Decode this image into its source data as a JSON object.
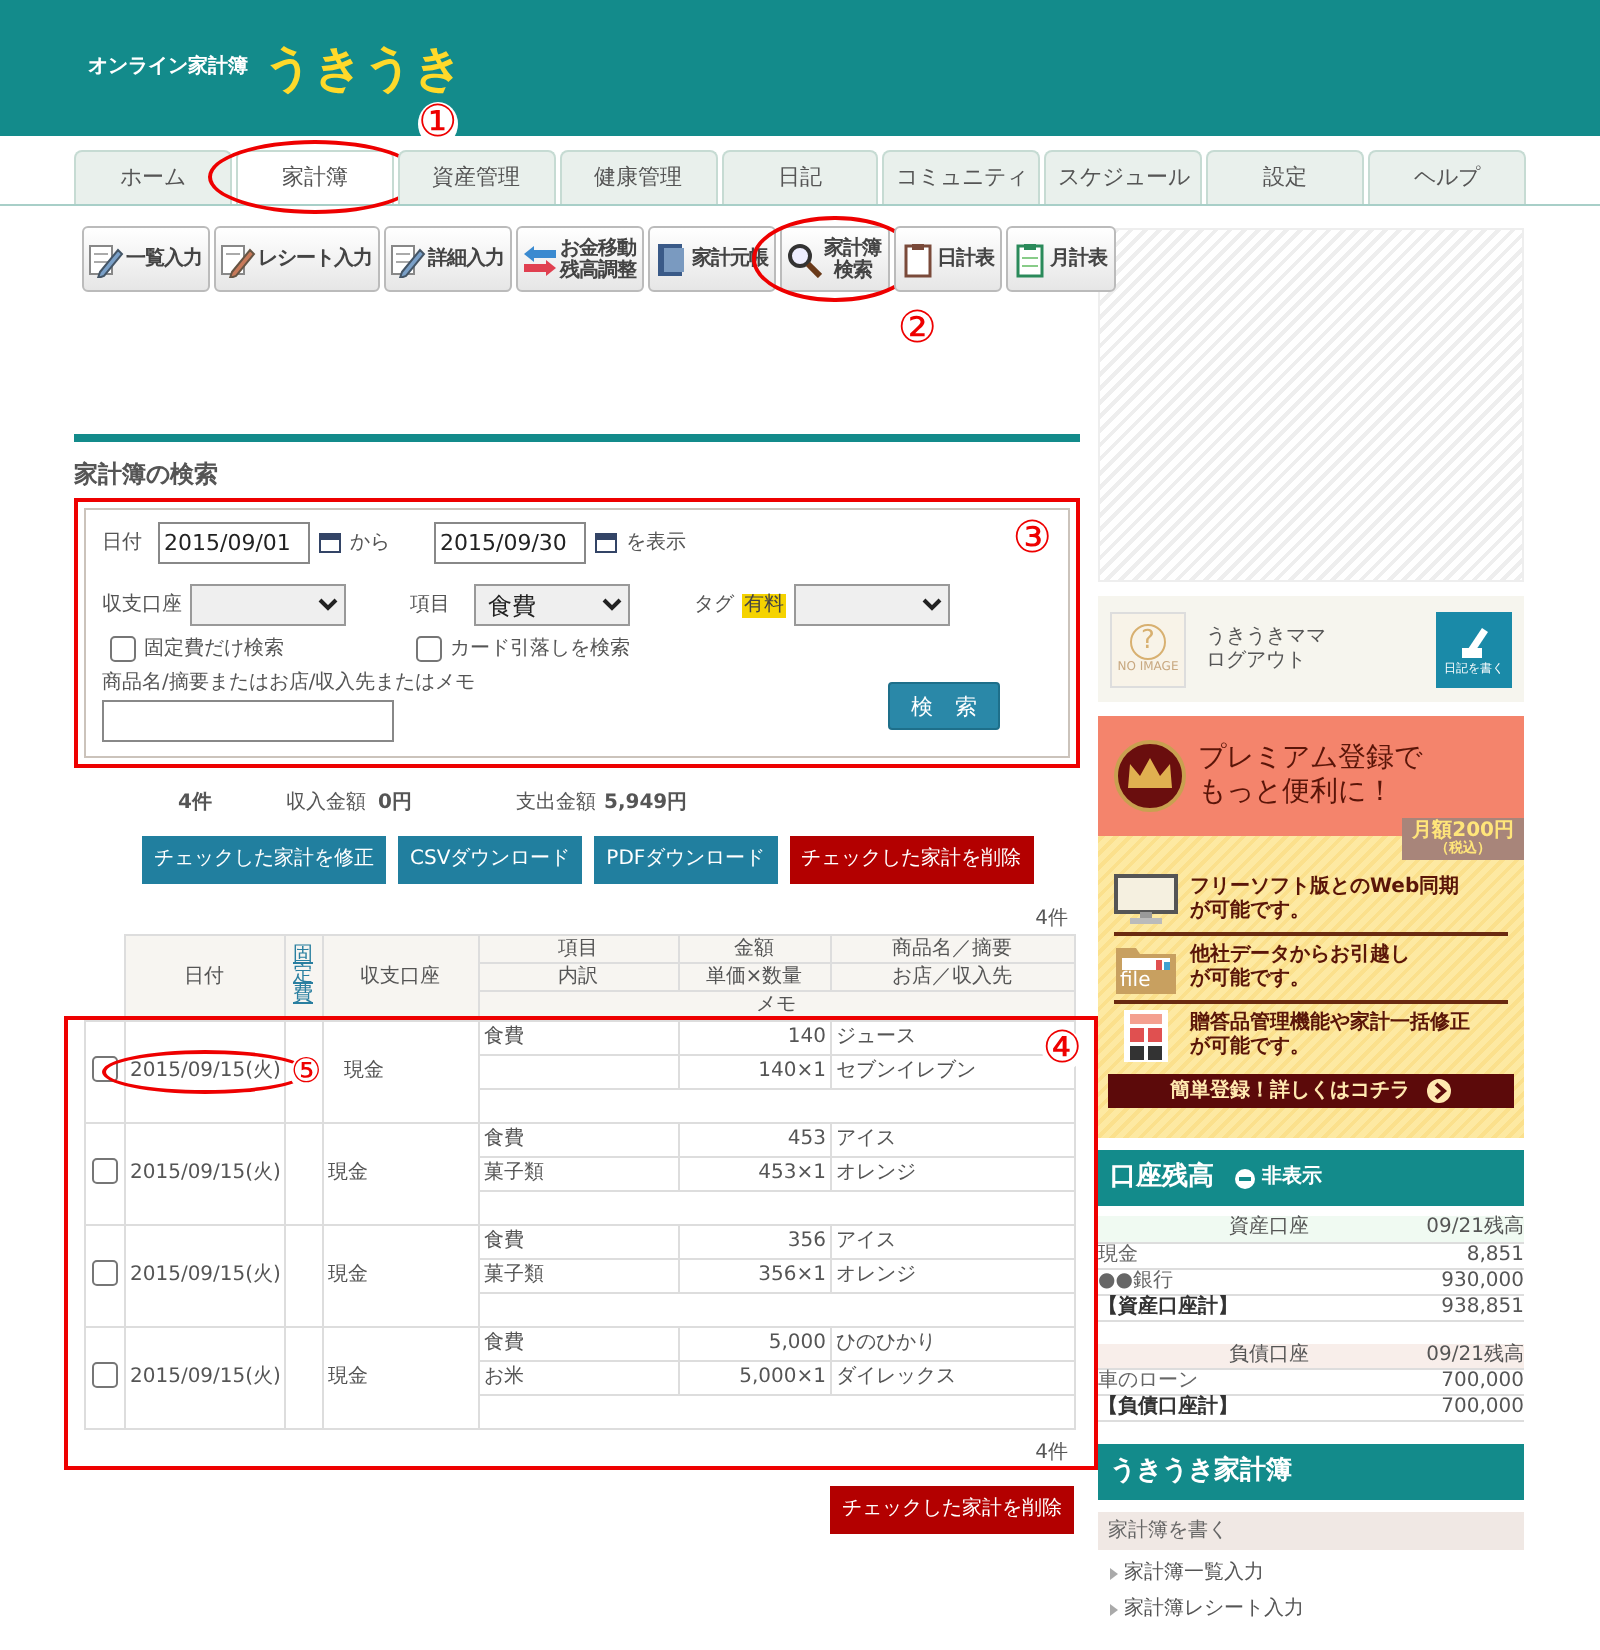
{
  "header": {
    "subtitle": "オンライン家計簿",
    "logo": "うきうき"
  },
  "tabs": [
    {
      "label": "ホーム",
      "selected": false
    },
    {
      "label": "家計簿",
      "selected": true,
      "annotation": "①"
    },
    {
      "label": "資産管理",
      "selected": false
    },
    {
      "label": "健康管理",
      "selected": false
    },
    {
      "label": "日記",
      "selected": false
    },
    {
      "label": "コミュニティ",
      "selected": false
    },
    {
      "label": "スケジュール",
      "selected": false
    },
    {
      "label": "設定",
      "selected": false
    },
    {
      "label": "ヘルプ",
      "selected": false
    }
  ],
  "toolbar": [
    {
      "lines": [
        "一覧入力"
      ]
    },
    {
      "lines": [
        "レシート入力"
      ]
    },
    {
      "lines": [
        "詳細入力"
      ]
    },
    {
      "lines": [
        "お金移動",
        "残高調整"
      ]
    },
    {
      "lines": [
        "家計元帳"
      ]
    },
    {
      "lines": [
        "家計簿",
        "検索"
      ],
      "annotation": "②"
    },
    {
      "lines": [
        "日計表"
      ]
    },
    {
      "lines": [
        "月計表"
      ]
    }
  ],
  "search": {
    "title": "家計簿の検索",
    "annotation": "③",
    "date_label": "日付",
    "date_from": "2015/09/01",
    "from_suffix": "から",
    "date_to": "2015/09/30",
    "to_suffix": "を表示",
    "account_label": "収支口座",
    "item_label": "項目",
    "item_value": "食費",
    "tag_label": "タグ",
    "tag_badge": "有料",
    "checkboxes": [
      {
        "label": "固定費だけ検索",
        "checked": false
      },
      {
        "label": "カード引落しを検索",
        "checked": false
      }
    ],
    "keyword_label": "商品名/摘要またはお店/収入先またはメモ",
    "button": "検　索"
  },
  "summary": {
    "count": "4件",
    "income_label": "収入金額",
    "income": "0円",
    "expense_label": "支出金額",
    "expense": "5,949円"
  },
  "actions": [
    {
      "label": "チェックした家計を修正",
      "kind": "primary"
    },
    {
      "label": "CSVダウンロード",
      "kind": "primary"
    },
    {
      "label": "PDFダウンロード",
      "kind": "primary"
    },
    {
      "label": "チェックした家計を削除",
      "kind": "danger"
    }
  ],
  "table": {
    "count_top": "4件",
    "count_bottom": "4件",
    "annotation": "④",
    "headers": {
      "date": "日付",
      "fixed": "固定費",
      "account": "収支口座",
      "item": "項目",
      "amount": "金額",
      "name": "商品名／摘要",
      "subitem": "内訳",
      "unit": "単価×数量",
      "shop": "お店／収入先",
      "memo": "メモ"
    },
    "rows": [
      {
        "checked": false,
        "date": "2015/09/15(火)",
        "account": "現金",
        "item": "食費",
        "amount": "140",
        "unit": "140×1",
        "name": "ジュース",
        "shop": "セブンイレブン",
        "annotation": "⑤"
      },
      {
        "checked": false,
        "date": "2015/09/15(火)",
        "account": "現金",
        "item": "食費",
        "subitem": "菓子類",
        "amount": "453",
        "unit": "453×1",
        "name": "アイス",
        "shop": "オレンジ"
      },
      {
        "checked": false,
        "date": "2015/09/15(火)",
        "account": "現金",
        "item": "食費",
        "subitem": "菓子類",
        "amount": "356",
        "unit": "356×1",
        "name": "アイス",
        "shop": "オレンジ"
      },
      {
        "checked": false,
        "date": "2015/09/15(火)",
        "account": "現金",
        "item": "食費",
        "subitem": "お米",
        "amount": "5,000",
        "unit": "5,000×1",
        "name": "ひのひかり",
        "shop": "ダイレックス"
      }
    ]
  },
  "bottom_action": {
    "label": "チェックした家計を削除",
    "kind": "danger"
  },
  "user": {
    "avatar_question": "?",
    "avatar_text": "NO IMAGE",
    "name": "うきうきママ",
    "logout": "ログアウト",
    "diary_button": "日記を書く"
  },
  "premium": {
    "title": "プレミアム登録で",
    "subtitle": "もっと便利に！",
    "price": "月額200円",
    "price_note": "（税込）",
    "features": [
      {
        "lines": [
          "フリーソフト版とのWeb同期",
          "が可能です。"
        ]
      },
      {
        "icon_text": "file",
        "lines": [
          "他社データからお引越し",
          "が可能です。"
        ]
      },
      {
        "lines": [
          "贈答品管理機能や家計一括修正",
          "が可能です。"
        ]
      }
    ],
    "cta": "簡単登録！詳しくはコチラ"
  },
  "balance": {
    "title": "口座残高",
    "hide": "非表示",
    "groups": [
      {
        "kind": "asset",
        "header": [
          "資産口座",
          "09/21残高"
        ],
        "rows": [
          {
            "label": "現金",
            "value": "8,851",
            "total": false
          },
          {
            "label": "●●銀行",
            "value": "930,000",
            "total": false
          },
          {
            "label": "【資産口座計】",
            "value": "938,851",
            "total": true
          }
        ]
      },
      {
        "kind": "liability",
        "header": [
          "負債口座",
          "09/21残高"
        ],
        "rows": [
          {
            "label": "車のローン",
            "value": "700,000",
            "total": false
          },
          {
            "label": "【負債口座計】",
            "value": "700,000",
            "total": true
          }
        ]
      }
    ]
  },
  "menu": {
    "title": "うきうき家計簿",
    "section": "家計簿を書く",
    "links": [
      "家計簿一覧入力",
      "家計簿レシート入力"
    ]
  }
}
